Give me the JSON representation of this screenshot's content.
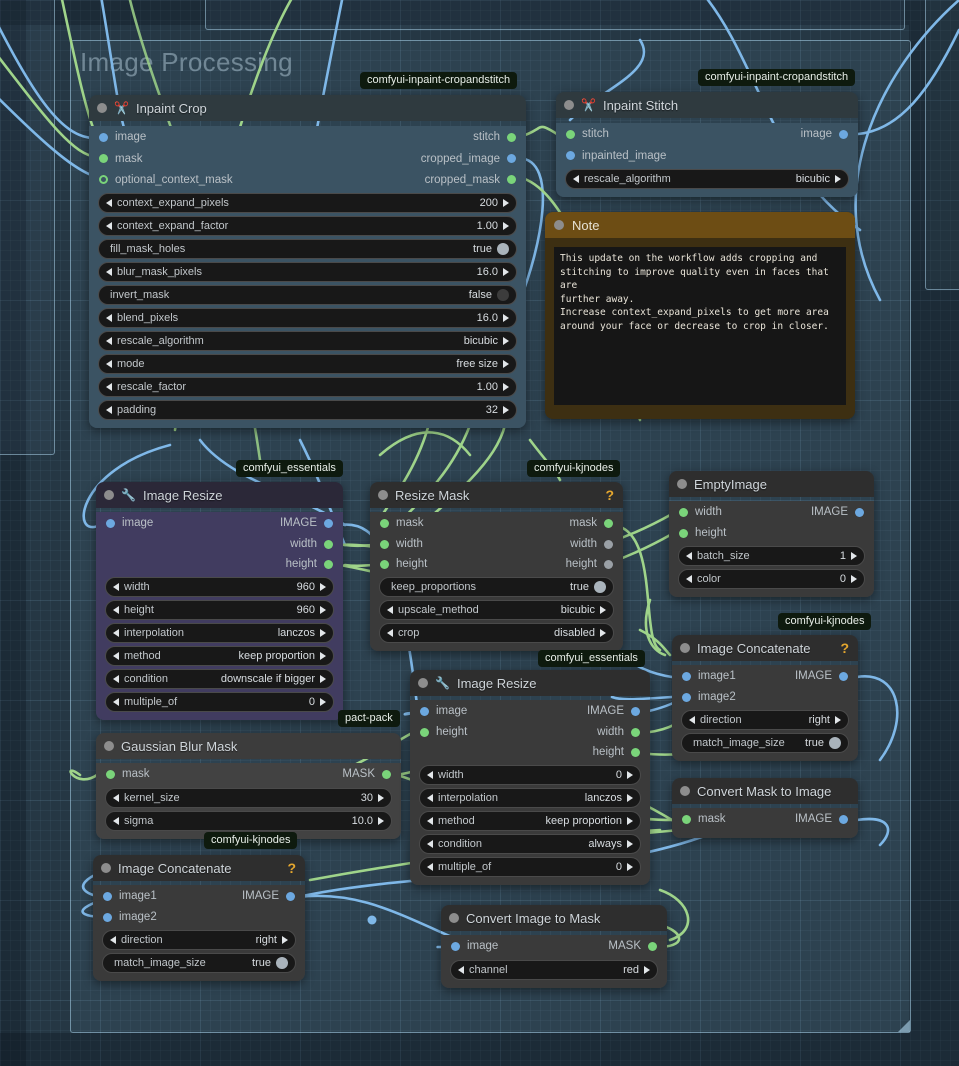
{
  "canvas": {
    "background_color": "#253744",
    "grid": true
  },
  "groups": [
    {
      "title": "Image Processing",
      "color": "#a5cde6"
    }
  ],
  "nodes": [
    {
      "id": "inpaint-crop",
      "title": "Inpaint Crop",
      "icon": "scissors-icon",
      "badge": "comfyui-inpaint-cropandstitch",
      "header_color": "#2f3a3f",
      "body_color": "#3b5363",
      "inputs": [
        {
          "label": "image",
          "color": "#6ca8e0"
        },
        {
          "label": "mask",
          "color": "#7ad47a"
        },
        {
          "label": "optional_context_mask",
          "color": "#7ad47a",
          "optional": true
        }
      ],
      "outputs": [
        {
          "label": "stitch",
          "color": "#7ad47a"
        },
        {
          "label": "cropped_image",
          "color": "#6ca8e0"
        },
        {
          "label": "cropped_mask",
          "color": "#7ad47a"
        }
      ],
      "widgets": [
        {
          "name": "context_expand_pixels",
          "value": "200",
          "type": "stepper"
        },
        {
          "name": "context_expand_factor",
          "value": "1.00",
          "type": "stepper"
        },
        {
          "name": "fill_mask_holes",
          "value": "true",
          "type": "toggle",
          "on": true
        },
        {
          "name": "blur_mask_pixels",
          "value": "16.0",
          "type": "stepper"
        },
        {
          "name": "invert_mask",
          "value": "false",
          "type": "toggle",
          "on": false
        },
        {
          "name": "blend_pixels",
          "value": "16.0",
          "type": "stepper"
        },
        {
          "name": "rescale_algorithm",
          "value": "bicubic",
          "type": "stepper"
        },
        {
          "name": "mode",
          "value": "free size",
          "type": "stepper"
        },
        {
          "name": "rescale_factor",
          "value": "1.00",
          "type": "stepper"
        },
        {
          "name": "padding",
          "value": "32",
          "type": "stepper"
        }
      ]
    },
    {
      "id": "inpaint-stitch",
      "title": "Inpaint Stitch",
      "icon": "scissors-icon",
      "badge": "comfyui-inpaint-cropandstitch",
      "header_color": "#2f3a3f",
      "body_color": "#3b5363",
      "inputs": [
        {
          "label": "stitch",
          "color": "#7ad47a"
        },
        {
          "label": "inpainted_image",
          "color": "#6ca8e0"
        }
      ],
      "outputs": [
        {
          "label": "image",
          "color": "#6ca8e0"
        }
      ],
      "widgets": [
        {
          "name": "rescale_algorithm",
          "value": "bicubic",
          "type": "stepper"
        }
      ]
    },
    {
      "id": "note",
      "title": "Note",
      "type": "note",
      "text": "This update on the workflow adds cropping and\nstitching to improve quality even in faces that are\nfurther away.\nIncrease context_expand_pixels to get more area\naround your face or decrease to crop in closer."
    },
    {
      "id": "image-resize-1",
      "title": "Image Resize",
      "icon": "wrench-icon",
      "badge": "comfyui_essentials",
      "header_color": "#2b2838",
      "body_color": "#413c60",
      "inputs": [
        {
          "label": "image",
          "color": "#6ca8e0"
        }
      ],
      "outputs": [
        {
          "label": "IMAGE",
          "color": "#6ca8e0"
        },
        {
          "label": "width",
          "color": "#7ad47a"
        },
        {
          "label": "height",
          "color": "#7ad47a"
        }
      ],
      "widgets": [
        {
          "name": "width",
          "value": "960",
          "type": "stepper"
        },
        {
          "name": "height",
          "value": "960",
          "type": "stepper"
        },
        {
          "name": "interpolation",
          "value": "lanczos",
          "type": "stepper"
        },
        {
          "name": "method",
          "value": "keep proportion",
          "type": "stepper"
        },
        {
          "name": "condition",
          "value": "downscale if bigger",
          "type": "stepper"
        },
        {
          "name": "multiple_of",
          "value": "0",
          "type": "stepper"
        }
      ]
    },
    {
      "id": "resize-mask",
      "title": "Resize Mask",
      "badge": "comfyui-kjnodes",
      "help": "?",
      "header_color": "#2e2e2e",
      "body_color": "#3a3a3a",
      "inputs": [
        {
          "label": "mask",
          "color": "#7ad47a"
        },
        {
          "label": "width",
          "color": "#7ad47a"
        },
        {
          "label": "height",
          "color": "#7ad47a"
        }
      ],
      "outputs": [
        {
          "label": "mask",
          "color": "#7ad47a"
        },
        {
          "label": "width",
          "color": "#9aa0a6"
        },
        {
          "label": "height",
          "color": "#9aa0a6"
        }
      ],
      "widgets": [
        {
          "name": "keep_proportions",
          "value": "true",
          "type": "toggle",
          "on": true
        },
        {
          "name": "upscale_method",
          "value": "bicubic",
          "type": "stepper"
        },
        {
          "name": "crop",
          "value": "disabled",
          "type": "stepper"
        }
      ]
    },
    {
      "id": "empty-image",
      "title": "EmptyImage",
      "header_color": "#2e2e2e",
      "body_color": "#3a3a3a",
      "inputs": [
        {
          "label": "width",
          "color": "#7ad47a"
        },
        {
          "label": "height",
          "color": "#7ad47a"
        }
      ],
      "outputs": [
        {
          "label": "IMAGE",
          "color": "#6ca8e0"
        }
      ],
      "widgets": [
        {
          "name": "batch_size",
          "value": "1",
          "type": "stepper"
        },
        {
          "name": "color",
          "value": "0",
          "type": "stepper"
        }
      ]
    },
    {
      "id": "image-concat-1",
      "title": "Image Concatenate",
      "badge": "comfyui-kjnodes",
      "help": "?",
      "header_color": "#2e2e2e",
      "body_color": "#3a3a3a",
      "inputs": [
        {
          "label": "image1",
          "color": "#6ca8e0"
        },
        {
          "label": "image2",
          "color": "#6ca8e0"
        }
      ],
      "outputs": [
        {
          "label": "IMAGE",
          "color": "#6ca8e0"
        }
      ],
      "widgets": [
        {
          "name": "direction",
          "value": "right",
          "type": "stepper"
        },
        {
          "name": "match_image_size",
          "value": "true",
          "type": "toggle",
          "on": true
        }
      ]
    },
    {
      "id": "convert-mask-to-image",
      "title": "Convert Mask to Image",
      "header_color": "#2e2e2e",
      "body_color": "#3a3a3a",
      "inputs": [
        {
          "label": "mask",
          "color": "#7ad47a"
        }
      ],
      "outputs": [
        {
          "label": "IMAGE",
          "color": "#6ca8e0"
        }
      ],
      "widgets": []
    },
    {
      "id": "gaussian-blur-mask",
      "title": "Gaussian Blur Mask",
      "badge": "pact-pack",
      "header_color": "#3c3c3c",
      "body_color": "#424242",
      "inputs": [
        {
          "label": "mask",
          "color": "#7ad47a"
        }
      ],
      "outputs": [
        {
          "label": "MASK",
          "color": "#7ad47a"
        }
      ],
      "widgets": [
        {
          "name": "kernel_size",
          "value": "30",
          "type": "stepper"
        },
        {
          "name": "sigma",
          "value": "10.0",
          "type": "stepper"
        }
      ]
    },
    {
      "id": "image-resize-2",
      "title": "Image Resize",
      "icon": "wrench-icon",
      "badge": "comfyui_essentials",
      "header_color": "#2e2e2e",
      "body_color": "#3a3a3a",
      "inputs": [
        {
          "label": "image",
          "color": "#6ca8e0"
        },
        {
          "label": "height",
          "color": "#7ad47a"
        }
      ],
      "outputs": [
        {
          "label": "IMAGE",
          "color": "#6ca8e0"
        },
        {
          "label": "width",
          "color": "#7ad47a"
        },
        {
          "label": "height",
          "color": "#7ad47a"
        }
      ],
      "widgets": [
        {
          "name": "width",
          "value": "0",
          "type": "stepper"
        },
        {
          "name": "interpolation",
          "value": "lanczos",
          "type": "stepper"
        },
        {
          "name": "method",
          "value": "keep proportion",
          "type": "stepper"
        },
        {
          "name": "condition",
          "value": "always",
          "type": "stepper"
        },
        {
          "name": "multiple_of",
          "value": "0",
          "type": "stepper"
        }
      ]
    },
    {
      "id": "image-concat-2",
      "title": "Image Concatenate",
      "badge": "comfyui-kjnodes",
      "help": "?",
      "header_color": "#2e2e2e",
      "body_color": "#3a3a3a",
      "inputs": [
        {
          "label": "image1",
          "color": "#6ca8e0"
        },
        {
          "label": "image2",
          "color": "#6ca8e0"
        }
      ],
      "outputs": [
        {
          "label": "IMAGE",
          "color": "#6ca8e0"
        }
      ],
      "widgets": [
        {
          "name": "direction",
          "value": "right",
          "type": "stepper"
        },
        {
          "name": "match_image_size",
          "value": "true",
          "type": "toggle",
          "on": true
        }
      ]
    },
    {
      "id": "convert-image-to-mask",
      "title": "Convert Image to Mask",
      "header_color": "#2e2e2e",
      "body_color": "#3a3a3a",
      "inputs": [
        {
          "label": "image",
          "color": "#6ca8e0"
        }
      ],
      "outputs": [
        {
          "label": "MASK",
          "color": "#7ad47a"
        }
      ],
      "widgets": [
        {
          "name": "channel",
          "value": "red",
          "type": "stepper"
        }
      ]
    }
  ],
  "link_colors": {
    "image": "#7fb8e8",
    "mask": "#9fd48a"
  }
}
